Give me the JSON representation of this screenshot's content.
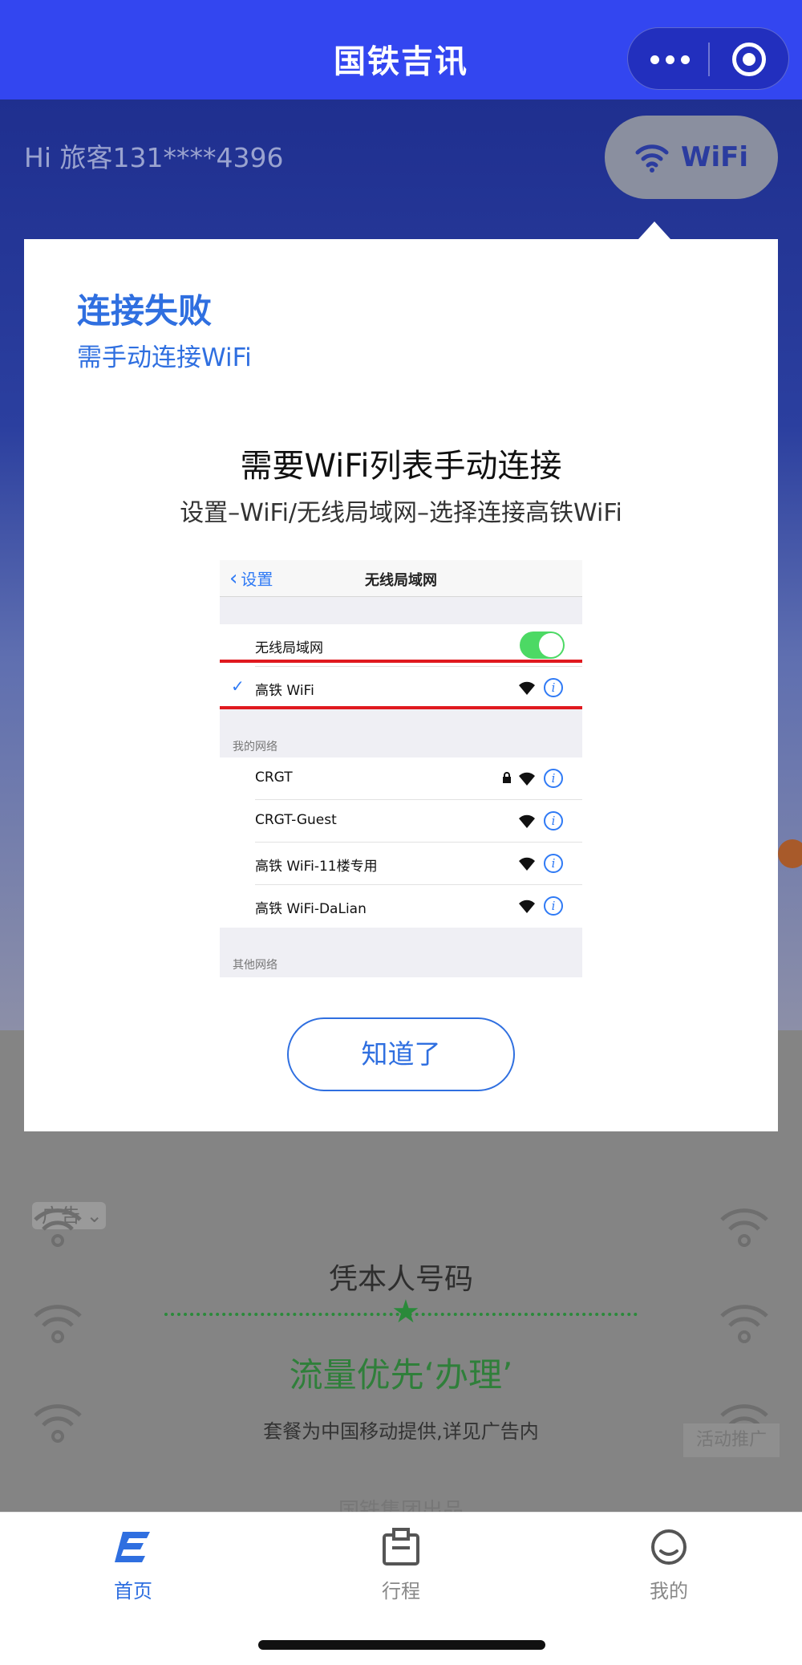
{
  "nav": {
    "title": "国铁吉讯"
  },
  "page": {
    "greeting": "Hi 旅客131****4396",
    "wifi_button": "WiFi",
    "ad": {
      "badge": "广告",
      "title": "凭本人号码",
      "slogan": "流量优先‘办理’",
      "subtitle": "套餐为中国移动提供,详见广告内",
      "promo_tag": "活动推广",
      "footer": "国铁集团出品"
    }
  },
  "dialog": {
    "title": "连接失败",
    "subtitle": "需手动连接WiFi",
    "heading": "需要WiFi列表手动连接",
    "path": "设置–WiFi/无线局域网–选择连接高铁WiFi",
    "phone": {
      "back_label": "设置",
      "header_title": "无线局域网",
      "wlan_label": "无线局域网",
      "connected": "高铁 WiFi",
      "my_networks_label": "我的网络",
      "networks": [
        "CRGT",
        "CRGT-Guest",
        "高铁 WiFi-11楼专用",
        "高铁 WiFi-DaLian"
      ],
      "other_networks_label": "其他网络"
    },
    "button": "知道了"
  },
  "tabs": [
    {
      "label": "首页",
      "icon": "home-icon",
      "active": true
    },
    {
      "label": "行程",
      "icon": "trip-icon",
      "active": false
    },
    {
      "label": "我的",
      "icon": "profile-icon",
      "active": false
    }
  ],
  "colors": {
    "brand": "#3346f0",
    "accent": "#2f6fe0",
    "highlight": "#e0191f",
    "toggle_on": "#4cd964"
  }
}
